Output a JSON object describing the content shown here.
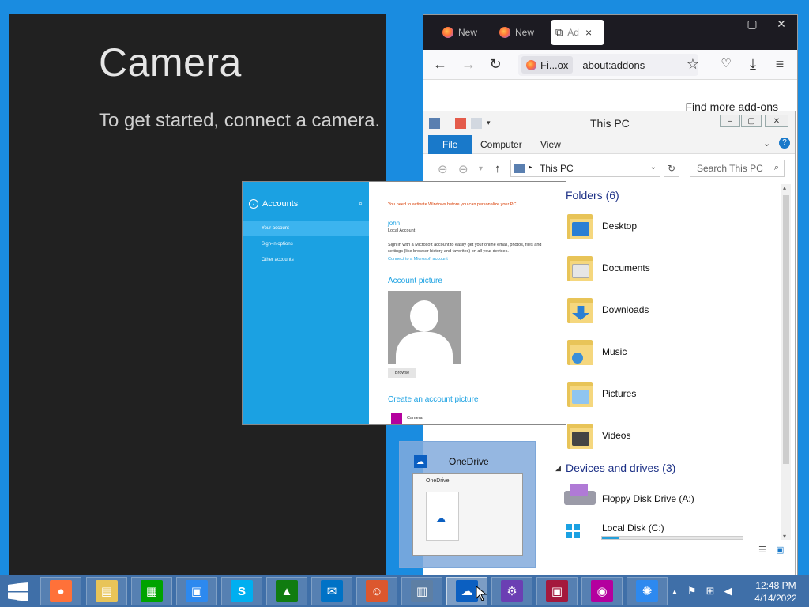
{
  "camera": {
    "title": "Camera",
    "message": "To get started, connect a camera."
  },
  "firefox": {
    "tabs": [
      {
        "label": "New"
      },
      {
        "label": "New"
      },
      {
        "label": "Ad"
      }
    ],
    "active_tab_close": "×",
    "identity_chip": "Fi...ox",
    "url": "about:addons",
    "find_more": "Find more add-ons",
    "window_controls": {
      "minimize": "–",
      "maximize": "▢",
      "close": "✕"
    }
  },
  "explorer": {
    "title": "This PC",
    "ribbon_tabs": {
      "file": "File",
      "computer": "Computer",
      "view": "View"
    },
    "address": "This PC",
    "search_placeholder": "Search This PC",
    "folders_header": "Folders (6)",
    "folders": [
      {
        "name": "Desktop",
        "badge_color": "#2a7fd4"
      },
      {
        "name": "Documents",
        "badge_color": "#e6e6e6"
      },
      {
        "name": "Downloads",
        "badge_color": "#2a7fd4"
      },
      {
        "name": "Music",
        "badge_color": "#3a8fd9"
      },
      {
        "name": "Pictures",
        "badge_color": "#8fc5f0"
      },
      {
        "name": "Videos",
        "badge_color": "#444444"
      }
    ],
    "devices_header": "Devices and drives (3)",
    "drives": [
      {
        "name": "Floppy Disk Drive (A:)"
      },
      {
        "name": "Local Disk (C:)",
        "used_fraction": 0.12
      }
    ]
  },
  "accounts": {
    "header": "Accounts",
    "menu": [
      {
        "label": "Your account",
        "selected": true
      },
      {
        "label": "Sign-in options",
        "selected": false
      },
      {
        "label": "Other accounts",
        "selected": false
      }
    ],
    "warning": "You need to activate Windows before you can personalize your PC.",
    "user_name": "john",
    "account_type": "Local Account",
    "description": "Sign in with a Microsoft account to easily get your online email, photos, files and settings (like browser history and favorites) on all your devices.",
    "connect_link": "Connect to a Microsoft account",
    "picture_header": "Account picture",
    "browse_label": "Browse",
    "create_header": "Create an account picture",
    "camera_label": "Camera"
  },
  "onedrive_preview": {
    "label": "OneDrive",
    "preview_title": "OneDrive"
  },
  "taskbar": {
    "apps": [
      {
        "name": "firefox",
        "color": "#ff7139",
        "glyph": "●"
      },
      {
        "name": "file-explorer",
        "color": "#e8c458",
        "glyph": "▤"
      },
      {
        "name": "store",
        "color": "#00a300",
        "glyph": "▦"
      },
      {
        "name": "control-panel",
        "color": "#2d89ef",
        "glyph": "▣"
      },
      {
        "name": "skype",
        "color": "#00aff0",
        "glyph": "S"
      },
      {
        "name": "games",
        "color": "#107c10",
        "glyph": "▲"
      },
      {
        "name": "mail",
        "color": "#0072c6",
        "glyph": "✉"
      },
      {
        "name": "people",
        "color": "#dc572e",
        "glyph": "☺"
      },
      {
        "name": "task-manager",
        "color": "#5e7fa4",
        "glyph": "▥"
      },
      {
        "name": "onedrive",
        "color": "#0b5fc1",
        "glyph": "☁"
      },
      {
        "name": "settings",
        "color": "#6b3fb3",
        "glyph": "⚙"
      },
      {
        "name": "photos",
        "color": "#a4193d",
        "glyph": "▣"
      },
      {
        "name": "camera",
        "color": "#b4009e",
        "glyph": "◉"
      },
      {
        "name": "brightness",
        "color": "#2d89ef",
        "glyph": "✺"
      }
    ],
    "tray": {
      "up": "▲",
      "flag": "⚑",
      "network": "⊞",
      "volume": "◀"
    },
    "time": "12:48 PM",
    "date": "4/14/2022"
  }
}
